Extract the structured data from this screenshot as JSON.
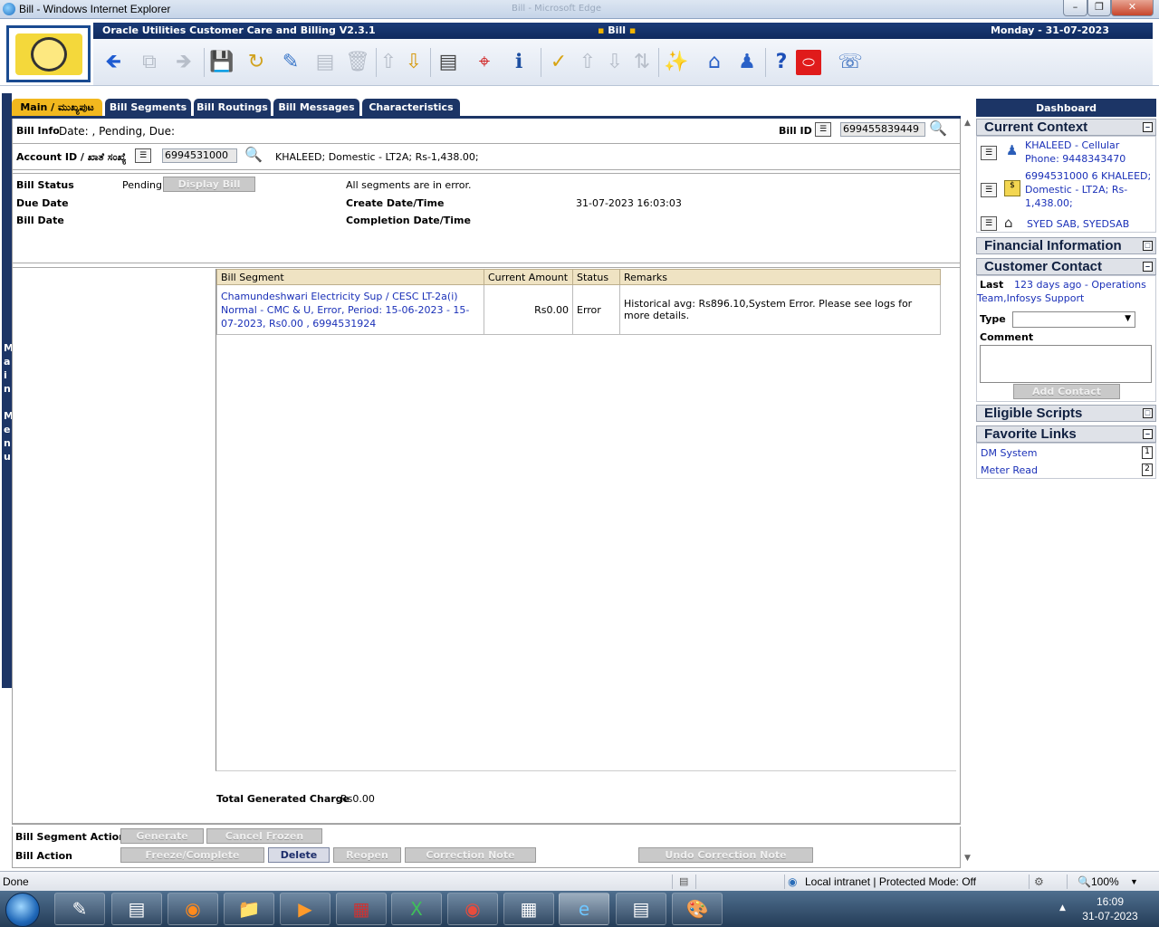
{
  "window": {
    "title": "Bill - Windows Internet Explorer",
    "ghost_title": "Bill - Microsoft Edge"
  },
  "header": {
    "app_title": "Oracle Utilities Customer Care and Billing V2.3.1",
    "page_name": "Bill",
    "date": "Monday - 31-07-2023"
  },
  "toolbar": {
    "icons": [
      "back-icon",
      "copy-icon",
      "forward-icon",
      "save-icon",
      "refresh-icon",
      "clear-icon",
      "duplicate-icon",
      "delete-icon",
      "scroll-up-icon",
      "scroll-down-icon",
      "list-icon",
      "target-icon",
      "info-icon",
      "check-icon",
      "up-icon",
      "down-icon",
      "updown-icon",
      "magic-icon",
      "home-icon",
      "users-icon",
      "help-icon",
      "oracle-icon",
      "phone-icon"
    ]
  },
  "menu": {
    "label": "Main Menu"
  },
  "tabs": [
    {
      "label": "Main / ಮುಖ್ಯಪುಟ",
      "active": true
    },
    {
      "label": "Bill Segments",
      "active": false
    },
    {
      "label": "Bill Routings",
      "active": false
    },
    {
      "label": "Bill Messages",
      "active": false
    },
    {
      "label": "Characteristics",
      "active": false
    }
  ],
  "bill": {
    "info_label": "Bill Info",
    "info_value": "Date: , Pending, Due:",
    "bill_id_label": "Bill ID",
    "bill_id": "699455839449",
    "account_label": "Account ID / ಖಾತೆ ಸಂಖ್ಯೆ",
    "account_id": "6994531000",
    "account_desc": "KHALEED; Domestic - LT2A; Rs-1,438.00;",
    "status_label": "Bill Status",
    "status_value": "Pending",
    "display_bill_btn": "Display Bill",
    "segments_msg": "All segments are in error.",
    "due_date_label": "Due Date",
    "create_label": "Create Date/Time",
    "create_value": "31-07-2023 16:03:03",
    "bill_date_label": "Bill Date",
    "completion_label": "Completion Date/Time"
  },
  "grid": {
    "headers": [
      "Bill Segment",
      "Current Amount",
      "Status",
      "Remarks"
    ],
    "rows": [
      {
        "segment": "Chamundeshwari Electricity Sup / CESC LT-2a(i) Normal - CMC & U, Error, Period: 15-06-2023 - 15-07-2023, Rs0.00 , 6994531924",
        "amount": "Rs0.00",
        "status": "Error",
        "remarks": "Historical avg: Rs896.10,System Error. Please see logs for more details."
      }
    ]
  },
  "totals": {
    "label": "Total Generated Charge",
    "value": "Rs0.00"
  },
  "actions": {
    "segment_label": "Bill Segment Action",
    "generate": "Generate",
    "cancel_frozen": "Cancel Frozen",
    "bill_label": "Bill Action",
    "freeze": "Freeze/Complete",
    "delete": "Delete",
    "reopen": "Reopen",
    "correction_note": "Correction Note",
    "undo_correction": "Undo Correction Note"
  },
  "dashboard": {
    "title": "Dashboard",
    "current_context": "Current Context",
    "ctx_person": "KHALEED - Cellular Phone: 9448343470",
    "ctx_account": "6994531000 6 KHALEED; Domestic - LT2A; Rs-1,438.00;",
    "ctx_premise": "SYED SAB, SYEDSAB",
    "financial": "Financial Information",
    "customer_contact": "Customer Contact",
    "last_label": "Last",
    "last_value": "123 days ago - Operations Team,Infosys Support",
    "type_label": "Type",
    "comment_label": "Comment",
    "add_contact": "Add Contact",
    "eligible_scripts": "Eligible Scripts",
    "favorite_links": "Favorite Links",
    "links": [
      {
        "label": "DM System",
        "key": "1"
      },
      {
        "label": "Meter Read",
        "key": "2"
      }
    ]
  },
  "status": {
    "text": "Done",
    "zone": "Local intranet | Protected Mode: Off",
    "zoom": "100%"
  },
  "clock": {
    "time": "16:09",
    "date": "31-07-2023"
  }
}
